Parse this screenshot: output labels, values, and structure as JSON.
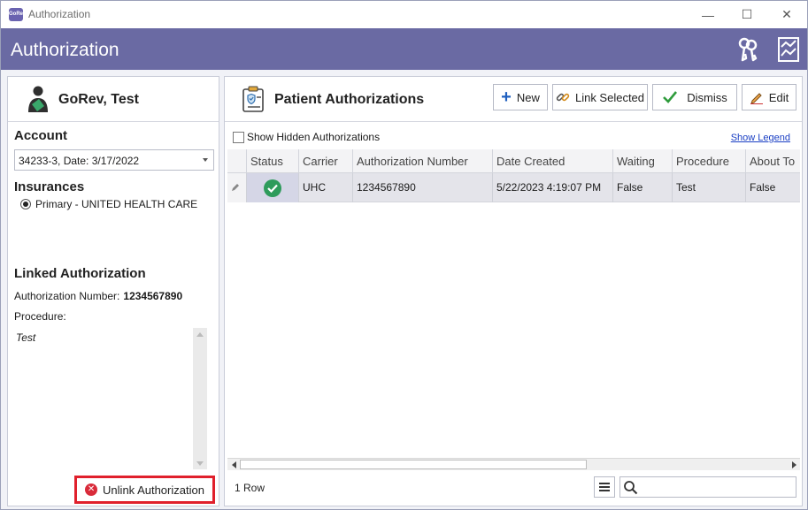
{
  "window": {
    "title": "Authorization",
    "app_icon_text": "GoRev",
    "controls": {
      "minimize": "—",
      "maximize": "☐",
      "close": "✕"
    }
  },
  "header": {
    "title": "Authorization",
    "icons": [
      "keys-icon",
      "chart-icon"
    ]
  },
  "patient": {
    "name": "GoRev,  Test"
  },
  "account": {
    "label": "Account",
    "selected": "34233-3, Date: 3/17/2022"
  },
  "insurances": {
    "label": "Insurances",
    "items": [
      {
        "label": "Primary - UNITED HEALTH CARE",
        "selected": true
      }
    ]
  },
  "linked_authorization": {
    "label": "Linked Authorization",
    "auth_number_label": "Authorization Number:",
    "auth_number": "1234567890",
    "procedure_label": "Procedure:",
    "procedure": "Test"
  },
  "unlink_button": {
    "label": "Unlink Authorization"
  },
  "patient_authorizations": {
    "title": "Patient Authorizations",
    "toolbar": {
      "new": "New",
      "link_selected": "Link Selected",
      "dismiss": "Dismiss",
      "edit": "Edit"
    },
    "show_hidden_label": "Show Hidden Authorizations",
    "show_legend": "Show Legend",
    "columns": [
      "Status",
      "Carrier",
      "Authorization Number",
      "Date Created",
      "Waiting",
      "Procedure",
      "About To"
    ],
    "rows": [
      {
        "status": "approved",
        "carrier": "UHC",
        "authorization_number": "1234567890",
        "date_created": "5/22/2023 4:19:07 PM",
        "waiting": "False",
        "procedure": "Test",
        "about_to": "False"
      }
    ],
    "row_count": "1 Row",
    "search": {
      "value": "",
      "placeholder": ""
    }
  },
  "colors": {
    "header_band": "#6a6aa3",
    "status_ok": "#2e9b5b",
    "unlink_highlight": "#e0202c",
    "link": "#1a3fc4"
  }
}
